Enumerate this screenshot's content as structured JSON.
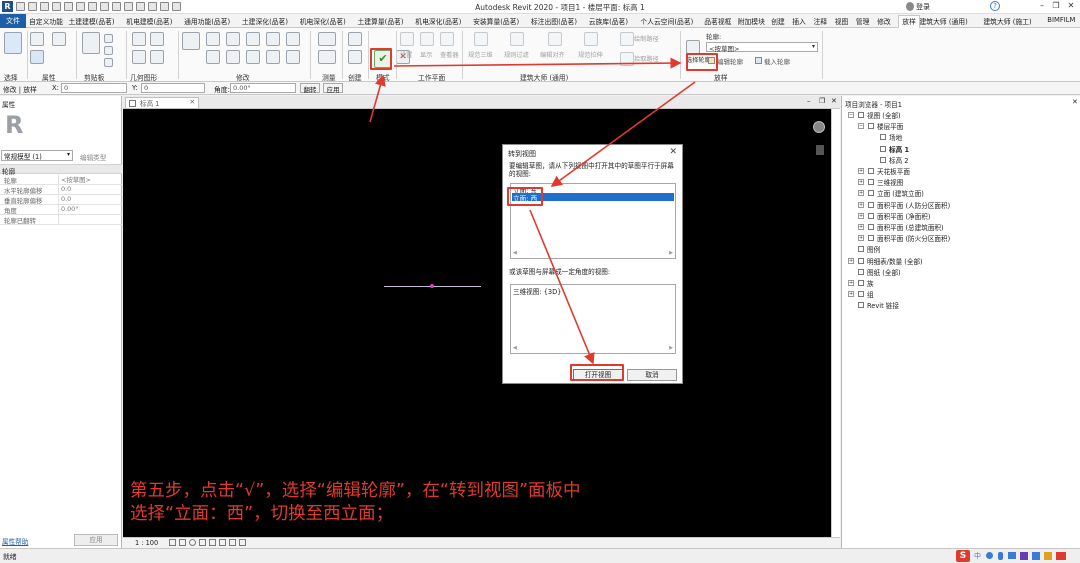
{
  "window": {
    "title": "Autodesk Revit 2020 - 项目1 - 楼层平面: 标高 1",
    "user": "登录",
    "help": "?"
  },
  "tabs": [
    "自定义功能",
    "土建建模(品茗)",
    "机电建模(品茗)",
    "通用功能(品茗)",
    "土建深化(品茗)",
    "机电深化(品茗)",
    "土建算量(品茗)",
    "机电深化(品茗)",
    "安装算量(品茗)",
    "标注出图(品茗)",
    "云族库(品茗)",
    "个人云空间(品茗)",
    "品茗视框",
    "附加模块",
    "创建",
    "插入",
    "注释",
    "视图",
    "管理",
    "修改",
    "放样",
    "建筑大师 (通用)",
    "建筑大师 (施工)",
    "BIMFILM"
  ],
  "file_tab": "文件",
  "active_tab": "放样",
  "ribbon": {
    "groups": [
      "选择",
      "属性",
      "剪贴板",
      "几何图形",
      "修改",
      "测量",
      "创建",
      "模式",
      "工作平面",
      "建筑大师 (通用)",
      "放样"
    ],
    "fade_labels": [
      "设置",
      "显示",
      "查看器",
      "规范三维",
      "规则过滤",
      "编辑对齐",
      "规范拉伸",
      "绘制路径",
      "拾取路径"
    ],
    "profile_label": "轮廓:",
    "profile_value": "<按草图>",
    "select_profile": "选择轮廓",
    "edit_profile": "编辑轮廓",
    "load_profile": "载入轮廓"
  },
  "optbar": {
    "context": "修改 | 放样",
    "x_label": "X:",
    "x_value": "0",
    "y_label": "Y:",
    "y_value": "0",
    "angle_label": "角度:",
    "angle_value": "0.00°",
    "flip": "翻转",
    "apply": "应用"
  },
  "properties": {
    "title": "属性",
    "type_selector": "常规模型 (1)",
    "edit_type": "编辑类型",
    "section": "轮廓",
    "rows": [
      {
        "k": "轮廓",
        "v": "<按草图>"
      },
      {
        "k": "水平轮廓偏移",
        "v": "0.0"
      },
      {
        "k": "垂直轮廓偏移",
        "v": "0.0"
      },
      {
        "k": "角度",
        "v": "0.00°"
      },
      {
        "k": "轮廓已翻转",
        "v": ""
      }
    ],
    "help_link": "属性帮助",
    "apply": "应用"
  },
  "view": {
    "tab_label": "标高 1",
    "scale": "1 : 100"
  },
  "dialog": {
    "title": "转到视图",
    "instruction": "要编辑草图，请从下列视图中打开其中的草图平行于屏幕的视图:",
    "list1": [
      "立面: 东",
      "立面: 西"
    ],
    "instruction2": "或该草图与屏幕成一定角度的视图:",
    "list2": [
      "三维视图: {3D}"
    ],
    "open_button": "打开视图",
    "cancel_button": "取消"
  },
  "browser": {
    "title": "项目浏览器 - 项目1",
    "nodes": [
      {
        "label": "视图 (全部)",
        "level": 0,
        "exp": "-"
      },
      {
        "label": "楼层平面",
        "level": 1,
        "exp": "-"
      },
      {
        "label": "场地",
        "level": 2,
        "exp": ""
      },
      {
        "label": "标高 1",
        "level": 2,
        "exp": "",
        "bold": true
      },
      {
        "label": "标高 2",
        "level": 2,
        "exp": ""
      },
      {
        "label": "天花板平面",
        "level": 1,
        "exp": "+"
      },
      {
        "label": "三维视图",
        "level": 1,
        "exp": "+"
      },
      {
        "label": "立面 (建筑立面)",
        "level": 1,
        "exp": "+"
      },
      {
        "label": "面积平面 (人防分区面积)",
        "level": 1,
        "exp": "+"
      },
      {
        "label": "面积平面 (净面积)",
        "level": 1,
        "exp": "+"
      },
      {
        "label": "面积平面 (总建筑面积)",
        "level": 1,
        "exp": "+"
      },
      {
        "label": "面积平面 (防火分区面积)",
        "level": 1,
        "exp": "+"
      },
      {
        "label": "图例",
        "level": 0,
        "exp": ""
      },
      {
        "label": "明细表/数量 (全部)",
        "level": 0,
        "exp": "+"
      },
      {
        "label": "图纸 (全部)",
        "level": 0,
        "exp": ""
      },
      {
        "label": "族",
        "level": 0,
        "exp": "+"
      },
      {
        "label": "组",
        "level": 0,
        "exp": "+"
      },
      {
        "label": "Revit 链接",
        "level": 0,
        "exp": ""
      }
    ]
  },
  "status": {
    "text": "就绪",
    "ime": "中"
  },
  "annotation": {
    "line1": "第五步，点击“√”，选择“编辑轮廓”，在“转到视图”面板中",
    "line2": "选择“立面：西”，切换至西立面；"
  },
  "colors": {
    "annotation": "#e03a2e",
    "file_tab": "#1f5fa8",
    "selection": "#1e6fd0"
  }
}
